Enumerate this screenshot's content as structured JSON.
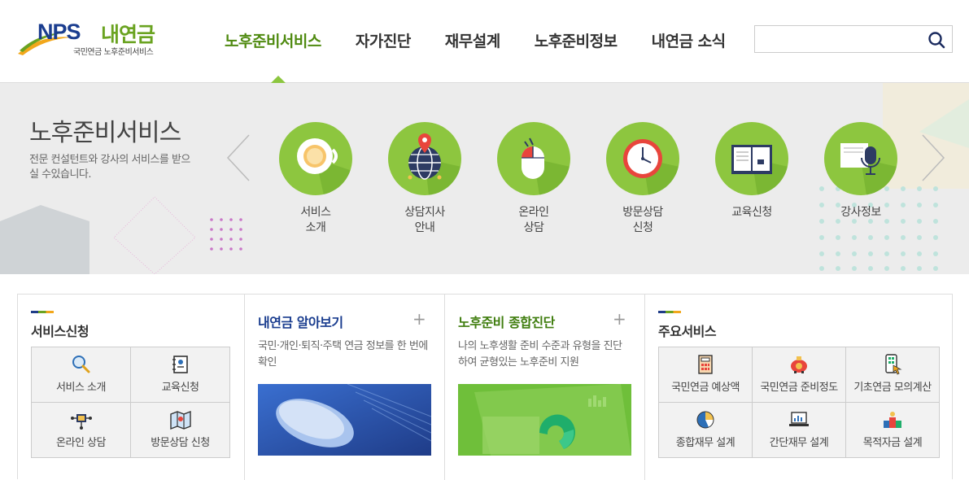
{
  "logo": {
    "nps": "NPS",
    "brand": "내연금",
    "sub": "국민연금 노후준비서비스"
  },
  "gnb": [
    {
      "label": "노후준비서비스",
      "active": true
    },
    {
      "label": "자가진단",
      "active": false
    },
    {
      "label": "재무설계",
      "active": false
    },
    {
      "label": "노후준비정보",
      "active": false
    },
    {
      "label": "내연금 소식",
      "active": false
    }
  ],
  "search": {
    "value": "",
    "placeholder": "",
    "icon": "search-icon"
  },
  "banner": {
    "title": "노후준비서비스",
    "desc": "전문 컨설턴트와 강사의 서비스를 받으실 수있습니다.",
    "services": [
      {
        "label": "서비스\n소개",
        "icon": "coffee-cup-icon"
      },
      {
        "label": "상담지사\n안내",
        "icon": "globe-location-icon"
      },
      {
        "label": "온라인\n상담",
        "icon": "mouse-icon"
      },
      {
        "label": "방문상담\n신청",
        "icon": "clock-icon"
      },
      {
        "label": "교육신청",
        "icon": "book-icon"
      },
      {
        "label": "강사정보",
        "icon": "microphone-icon"
      }
    ]
  },
  "panels": {
    "apply": {
      "title": "서비스신청",
      "items": [
        {
          "label": "서비스 소개",
          "icon": "magnifier-icon"
        },
        {
          "label": "교육신청",
          "icon": "notebook-icon"
        },
        {
          "label": "온라인 상담",
          "icon": "network-icon"
        },
        {
          "label": "방문상담 신청",
          "icon": "map-icon"
        }
      ]
    },
    "know": {
      "title": "내연금 알아보기",
      "desc": "국민·개인·퇴직·주택 연금 정보를 한 번에 확인",
      "plus": "+"
    },
    "diag": {
      "title": "노후준비 종합진단",
      "desc": "나의 노후생활 준비 수준과 유형을 진단하여 균형있는 노후준비 지원",
      "plus": "+"
    },
    "main": {
      "title": "주요서비스",
      "items": [
        {
          "label": "국민연금 예상액",
          "icon": "calculator-icon"
        },
        {
          "label": "국민연금 준비정도",
          "icon": "piggy-bank-icon"
        },
        {
          "label": "기초연금 모의계산",
          "icon": "phone-touch-icon"
        },
        {
          "label": "종합재무 설계",
          "icon": "pie-chart-icon"
        },
        {
          "label": "간단재무 설계",
          "icon": "laptop-chart-icon"
        },
        {
          "label": "목적자금 설계",
          "icon": "bags-icon"
        }
      ]
    }
  },
  "colors": {
    "green": "#8dc63f",
    "brand_blue": "#1a3d8f",
    "brand_green": "#6aa321"
  }
}
